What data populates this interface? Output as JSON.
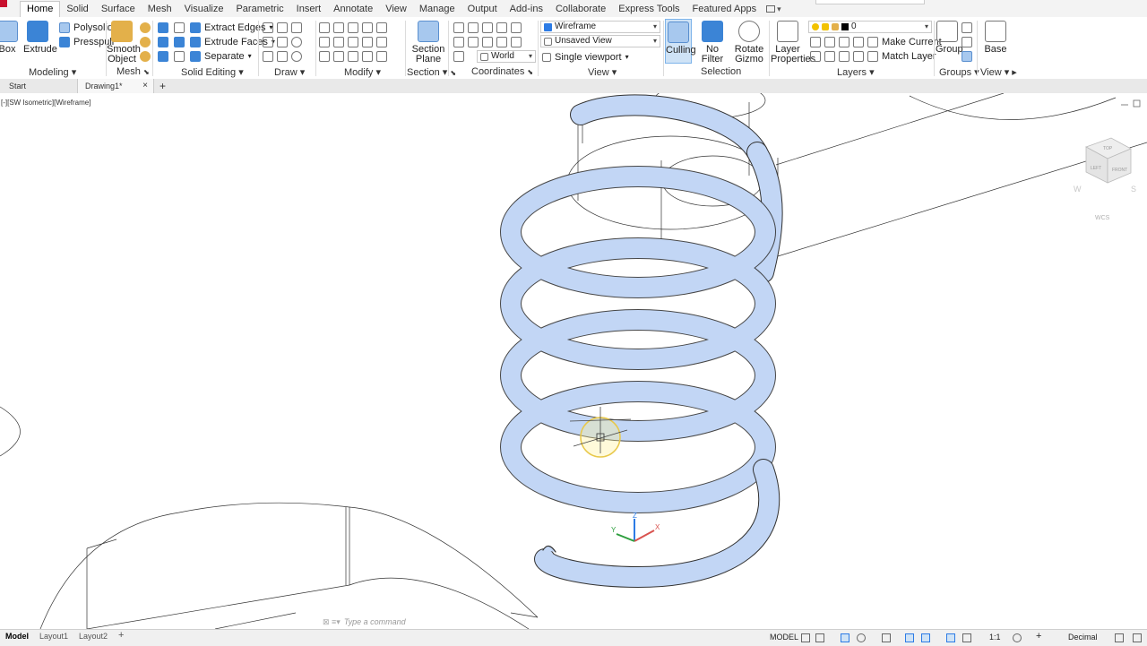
{
  "menu_tabs": [
    "Home",
    "Solid",
    "Surface",
    "Mesh",
    "Visualize",
    "Parametric",
    "Insert",
    "Annotate",
    "View",
    "Manage",
    "Output",
    "Add-ins",
    "Collaborate",
    "Express Tools",
    "Featured Apps"
  ],
  "active_tab": "Home",
  "ribbon": {
    "modeling": {
      "title": "Modeling",
      "box": "Box",
      "extrude": "Extrude",
      "polysolid": "Polysolid",
      "presspull": "Presspull"
    },
    "mesh": {
      "title": "Mesh",
      "smooth_object": "Smooth Object"
    },
    "solid_editing": {
      "title": "Solid Editing",
      "extract_edges": "Extract Edges",
      "extrude_faces": "Extrude Faces",
      "separate": "Separate"
    },
    "draw": {
      "title": "Draw"
    },
    "modify": {
      "title": "Modify"
    },
    "section": {
      "title": "Section",
      "section_plane": "Section Plane"
    },
    "coordinates": {
      "title": "Coordinates",
      "world": "World"
    },
    "view": {
      "title": "View",
      "visual_style": "Wireframe",
      "named_view": "Unsaved View",
      "viewport_config": "Single viewport"
    },
    "selection": {
      "title": "Selection",
      "culling": "Culling",
      "no_filter": "No Filter",
      "rotate_gizmo": "Rotate Gizmo"
    },
    "layers": {
      "title": "Layers",
      "layer_properties": "Layer Properties",
      "layer_name": "0",
      "make_current": "Make Current",
      "match_layer": "Match Layer"
    },
    "groups": {
      "title": "Groups",
      "group": "Group"
    },
    "viewpanel": {
      "title": "View",
      "base": "Base"
    }
  },
  "doc_tabs": {
    "start": "Start",
    "drawing": "Drawing1*"
  },
  "viewport": {
    "label": "[-][SW Isometric][Wireframe]",
    "viewcube_top": "TOP",
    "viewcube_left": "LEFT",
    "viewcube_front": "FRONT",
    "compass_w": "W",
    "compass_s": "S",
    "wcs": "WCS",
    "ucs_x": "X",
    "ucs_y": "Y",
    "ucs_z": "Z"
  },
  "command_line": {
    "placeholder": "Type a command"
  },
  "layout_tabs": [
    "Model",
    "Layout1",
    "Layout2"
  ],
  "status": {
    "model": "MODEL",
    "scale": "1:1",
    "units": "Decimal"
  },
  "colors": {
    "accent": "#2c7be5",
    "helix_fill": "#c2d6f5",
    "helix_edge": "#333333",
    "app_red": "#c8102e"
  }
}
